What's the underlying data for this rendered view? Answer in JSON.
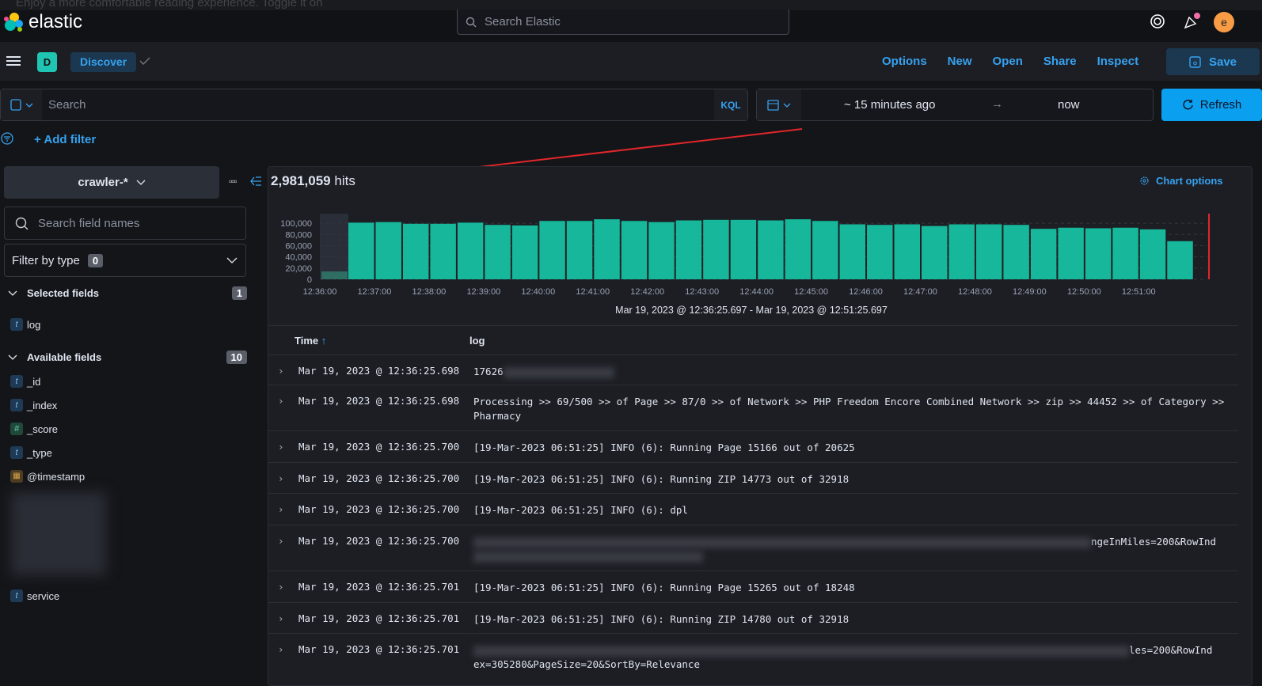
{
  "banner": "Enjoy a more comfortable reading experience. Toggle it on",
  "header": {
    "logo": "elastic",
    "search_placeholder": "Search Elastic",
    "avatar": "e",
    "icons": [
      "help-icon",
      "newsfeed-icon"
    ]
  },
  "appbar": {
    "space": "D",
    "app": "Discover",
    "menu": [
      "Options",
      "New",
      "Open",
      "Share",
      "Inspect"
    ],
    "save": "Save"
  },
  "query": {
    "placeholder": "Search",
    "language": "KQL",
    "start": "~ 15 minutes ago",
    "end": "now",
    "refresh": "Refresh",
    "add_filter": "+ Add filter"
  },
  "sidebar": {
    "index_pattern": "crawler-*",
    "search_placeholder": "Search field names",
    "filter_by_type": "Filter by type",
    "filter_count": "0",
    "selected_label": "Selected fields",
    "selected_count": "1",
    "selected": [
      {
        "type": "t",
        "name": "log"
      }
    ],
    "available_label": "Available fields",
    "available_count": "10",
    "available": [
      {
        "type": "t",
        "name": "_id"
      },
      {
        "type": "t",
        "name": "_index"
      },
      {
        "type": "#",
        "name": "_score"
      },
      {
        "type": "t",
        "name": "_type"
      },
      {
        "type": "cal",
        "name": "@timestamp"
      }
    ],
    "last_field": {
      "type": "t",
      "name": "service"
    }
  },
  "hits": {
    "count": "2,981,059",
    "label": "hits",
    "chart_options": "Chart options",
    "range": "Mar 19, 2023 @ 12:36:25.697 - Mar 19, 2023 @ 12:51:25.697"
  },
  "colors": {
    "bar": "#16b79a",
    "accent": "#36a2ef",
    "annotation": "#e0262a"
  },
  "chart_data": {
    "type": "bar",
    "x_interval": "30s",
    "categories": [
      "12:36:00",
      "12:36:30",
      "12:37:00",
      "12:37:30",
      "12:38:00",
      "12:38:30",
      "12:39:00",
      "12:39:30",
      "12:40:00",
      "12:40:30",
      "12:41:00",
      "12:41:30",
      "12:42:00",
      "12:42:30",
      "12:43:00",
      "12:43:30",
      "12:44:00",
      "12:44:30",
      "12:45:00",
      "12:45:30",
      "12:46:00",
      "12:46:30",
      "12:47:00",
      "12:47:30",
      "12:48:00",
      "12:48:30",
      "12:49:00",
      "12:49:30",
      "12:50:00",
      "12:50:30",
      "12:51:00"
    ],
    "values": [
      14000,
      101000,
      102000,
      99000,
      99000,
      101000,
      97000,
      96000,
      104000,
      104000,
      107000,
      104000,
      102000,
      105000,
      106000,
      106000,
      105000,
      107000,
      104000,
      98000,
      97000,
      98000,
      95000,
      98000,
      98000,
      97000,
      90000,
      92000,
      91000,
      92000,
      89000,
      68000
    ],
    "y_ticks": [
      "0",
      "20,000",
      "40,000",
      "60,000",
      "80,000",
      "100,000"
    ],
    "x_ticks": [
      "12:36:00",
      "12:37:00",
      "12:38:00",
      "12:39:00",
      "12:40:00",
      "12:41:00",
      "12:42:00",
      "12:43:00",
      "12:44:00",
      "12:45:00",
      "12:46:00",
      "12:47:00",
      "12:48:00",
      "12:49:00",
      "12:50:00",
      "12:51:00"
    ],
    "ylim": [
      0,
      110000
    ],
    "grid": true
  },
  "table": {
    "headers": [
      "Time",
      "log"
    ],
    "rows": [
      {
        "time": "Mar 19, 2023 @ 12:36:25.698",
        "log": "17626"
      },
      {
        "time": "Mar 19, 2023 @ 12:36:25.698",
        "log": "Processing >> 69/500 >> of Page >> 87/0 >> of Network >> PHP Freedom Encore Combined Network >> zip >> 44452 >> of Category >> Pharmacy"
      },
      {
        "time": "Mar 19, 2023 @ 12:36:25.700",
        "log": "[19-Mar-2023 06:51:25] INFO (6): Running Page 15166 out of 20625"
      },
      {
        "time": "Mar 19, 2023 @ 12:36:25.700",
        "log": "[19-Mar-2023 06:51:25] INFO (6): Running ZIP 14773 out of 32918"
      },
      {
        "time": "Mar 19, 2023 @ 12:36:25.700",
        "log": "[19-Mar-2023 06:51:25] INFO (6): dpl"
      },
      {
        "time": "Mar 19, 2023 @ 12:36:25.700",
        "log": "ngeInMiles=200&RowInd"
      },
      {
        "time": "Mar 19, 2023 @ 12:36:25.701",
        "log": "[19-Mar-2023 06:51:25] INFO (6): Running Page 15265 out of 18248"
      },
      {
        "time": "Mar 19, 2023 @ 12:36:25.701",
        "log": "[19-Mar-2023 06:51:25] INFO (6): Running ZIP 14780 out of 32918"
      },
      {
        "time": "Mar 19, 2023 @ 12:36:25.701",
        "log": "les=200&RowInd",
        "log2": "ex=305280&PageSize=20&SortBy=Relevance"
      }
    ]
  }
}
